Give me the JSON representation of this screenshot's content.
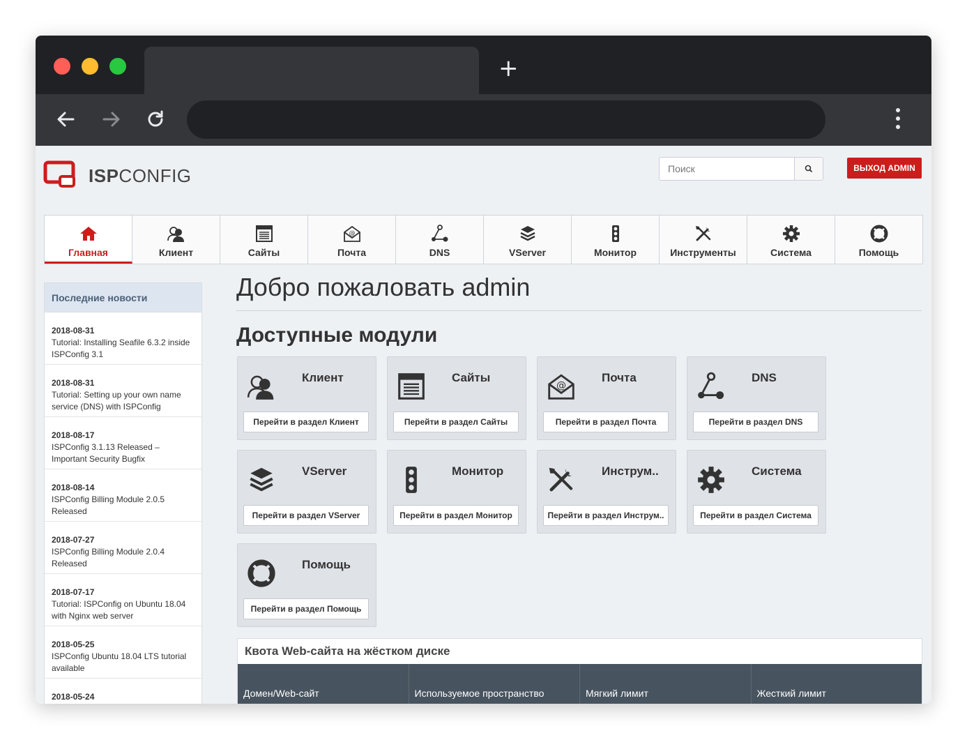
{
  "browser": {
    "new_tab": "+",
    "traffic_lights": [
      "#ff5f57",
      "#febc2e",
      "#28c840"
    ]
  },
  "header": {
    "logo_bold": "ISP",
    "logo_light": "CONFIG",
    "search_placeholder": "Поиск",
    "logout": "ВЫХОД ADMIN"
  },
  "nav": [
    {
      "label": "Главная",
      "icon": "home-icon",
      "active": true
    },
    {
      "label": "Клиент",
      "icon": "users-icon"
    },
    {
      "label": "Сайты",
      "icon": "sites-icon"
    },
    {
      "label": "Почта",
      "icon": "mail-icon"
    },
    {
      "label": "DNS",
      "icon": "dns-icon"
    },
    {
      "label": "VServer",
      "icon": "server-icon"
    },
    {
      "label": "Монитор",
      "icon": "monitor-icon"
    },
    {
      "label": "Инструменты",
      "icon": "tools-icon"
    },
    {
      "label": "Система",
      "icon": "gear-icon"
    },
    {
      "label": "Помощь",
      "icon": "help-icon"
    }
  ],
  "sidebar": {
    "title": "Последние новости",
    "news": [
      {
        "date": "2018-08-31",
        "text": "Tutorial: Installing Seafile 6.3.2 inside ISPConfig 3.1"
      },
      {
        "date": "2018-08-31",
        "text": "Tutorial: Setting up your own name service (DNS) with ISPConfig"
      },
      {
        "date": "2018-08-17",
        "text": "ISPConfig 3.1.13 Released – Important Security Bugfix"
      },
      {
        "date": "2018-08-14",
        "text": "ISPConfig Billing Module 2.0.5 Released"
      },
      {
        "date": "2018-07-27",
        "text": "ISPConfig Billing Module 2.0.4 Released"
      },
      {
        "date": "2018-07-17",
        "text": "Tutorial: ISPConfig on Ubuntu 18.04 with Nginx web server"
      },
      {
        "date": "2018-05-25",
        "text": "ISPConfig Ubuntu 18.04 LTS tutorial available"
      },
      {
        "date": "2018-05-24",
        "text": ""
      }
    ]
  },
  "main": {
    "welcome": "Добро пожаловать admin",
    "modules_title": "Доступные модули",
    "modules": [
      {
        "title": "Клиент",
        "button": "Перейти в раздел Клиент",
        "icon": "users-icon"
      },
      {
        "title": "Сайты",
        "button": "Перейти в раздел Сайты",
        "icon": "sites-icon"
      },
      {
        "title": "Почта",
        "button": "Перейти в раздел Почта",
        "icon": "mail-icon"
      },
      {
        "title": "DNS",
        "button": "Перейти в раздел DNS",
        "icon": "dns-icon"
      },
      {
        "title": "VServer",
        "button": "Перейти в раздел VServer",
        "icon": "server-icon"
      },
      {
        "title": "Монитор",
        "button": "Перейти в раздел Монитор",
        "icon": "monitor-icon"
      },
      {
        "title": "Инструм..",
        "button": "Перейти в раздел Инструм..",
        "icon": "tools-icon"
      },
      {
        "title": "Система",
        "button": "Перейти в раздел Система",
        "icon": "gear-icon"
      },
      {
        "title": "Помощь",
        "button": "Перейти в раздел Помощь",
        "icon": "help-icon"
      }
    ],
    "quota": {
      "title": "Квота Web-сайта на жёстком диске",
      "columns": [
        "Домен/Web-сайт",
        "Используемое пространство",
        "Мягкий лимит",
        "Жесткий лимит"
      ]
    }
  },
  "colors": {
    "accent": "#cc1d1d",
    "table_header": "#47535e",
    "sidebar_head": "#dde6f0"
  }
}
